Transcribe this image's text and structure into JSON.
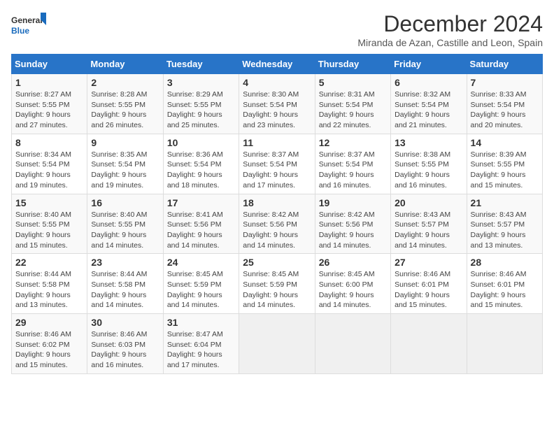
{
  "logo": {
    "line1": "General",
    "line2": "Blue"
  },
  "title": "December 2024",
  "subtitle": "Miranda de Azan, Castille and Leon, Spain",
  "weekdays": [
    "Sunday",
    "Monday",
    "Tuesday",
    "Wednesday",
    "Thursday",
    "Friday",
    "Saturday"
  ],
  "weeks": [
    [
      {
        "day": "1",
        "info": "Sunrise: 8:27 AM\nSunset: 5:55 PM\nDaylight: 9 hours\nand 27 minutes."
      },
      {
        "day": "2",
        "info": "Sunrise: 8:28 AM\nSunset: 5:55 PM\nDaylight: 9 hours\nand 26 minutes."
      },
      {
        "day": "3",
        "info": "Sunrise: 8:29 AM\nSunset: 5:55 PM\nDaylight: 9 hours\nand 25 minutes."
      },
      {
        "day": "4",
        "info": "Sunrise: 8:30 AM\nSunset: 5:54 PM\nDaylight: 9 hours\nand 23 minutes."
      },
      {
        "day": "5",
        "info": "Sunrise: 8:31 AM\nSunset: 5:54 PM\nDaylight: 9 hours\nand 22 minutes."
      },
      {
        "day": "6",
        "info": "Sunrise: 8:32 AM\nSunset: 5:54 PM\nDaylight: 9 hours\nand 21 minutes."
      },
      {
        "day": "7",
        "info": "Sunrise: 8:33 AM\nSunset: 5:54 PM\nDaylight: 9 hours\nand 20 minutes."
      }
    ],
    [
      {
        "day": "8",
        "info": "Sunrise: 8:34 AM\nSunset: 5:54 PM\nDaylight: 9 hours\nand 19 minutes."
      },
      {
        "day": "9",
        "info": "Sunrise: 8:35 AM\nSunset: 5:54 PM\nDaylight: 9 hours\nand 19 minutes."
      },
      {
        "day": "10",
        "info": "Sunrise: 8:36 AM\nSunset: 5:54 PM\nDaylight: 9 hours\nand 18 minutes."
      },
      {
        "day": "11",
        "info": "Sunrise: 8:37 AM\nSunset: 5:54 PM\nDaylight: 9 hours\nand 17 minutes."
      },
      {
        "day": "12",
        "info": "Sunrise: 8:37 AM\nSunset: 5:54 PM\nDaylight: 9 hours\nand 16 minutes."
      },
      {
        "day": "13",
        "info": "Sunrise: 8:38 AM\nSunset: 5:55 PM\nDaylight: 9 hours\nand 16 minutes."
      },
      {
        "day": "14",
        "info": "Sunrise: 8:39 AM\nSunset: 5:55 PM\nDaylight: 9 hours\nand 15 minutes."
      }
    ],
    [
      {
        "day": "15",
        "info": "Sunrise: 8:40 AM\nSunset: 5:55 PM\nDaylight: 9 hours\nand 15 minutes."
      },
      {
        "day": "16",
        "info": "Sunrise: 8:40 AM\nSunset: 5:55 PM\nDaylight: 9 hours\nand 14 minutes."
      },
      {
        "day": "17",
        "info": "Sunrise: 8:41 AM\nSunset: 5:56 PM\nDaylight: 9 hours\nand 14 minutes."
      },
      {
        "day": "18",
        "info": "Sunrise: 8:42 AM\nSunset: 5:56 PM\nDaylight: 9 hours\nand 14 minutes."
      },
      {
        "day": "19",
        "info": "Sunrise: 8:42 AM\nSunset: 5:56 PM\nDaylight: 9 hours\nand 14 minutes."
      },
      {
        "day": "20",
        "info": "Sunrise: 8:43 AM\nSunset: 5:57 PM\nDaylight: 9 hours\nand 14 minutes."
      },
      {
        "day": "21",
        "info": "Sunrise: 8:43 AM\nSunset: 5:57 PM\nDaylight: 9 hours\nand 13 minutes."
      }
    ],
    [
      {
        "day": "22",
        "info": "Sunrise: 8:44 AM\nSunset: 5:58 PM\nDaylight: 9 hours\nand 13 minutes."
      },
      {
        "day": "23",
        "info": "Sunrise: 8:44 AM\nSunset: 5:58 PM\nDaylight: 9 hours\nand 14 minutes."
      },
      {
        "day": "24",
        "info": "Sunrise: 8:45 AM\nSunset: 5:59 PM\nDaylight: 9 hours\nand 14 minutes."
      },
      {
        "day": "25",
        "info": "Sunrise: 8:45 AM\nSunset: 5:59 PM\nDaylight: 9 hours\nand 14 minutes."
      },
      {
        "day": "26",
        "info": "Sunrise: 8:45 AM\nSunset: 6:00 PM\nDaylight: 9 hours\nand 14 minutes."
      },
      {
        "day": "27",
        "info": "Sunrise: 8:46 AM\nSunset: 6:01 PM\nDaylight: 9 hours\nand 15 minutes."
      },
      {
        "day": "28",
        "info": "Sunrise: 8:46 AM\nSunset: 6:01 PM\nDaylight: 9 hours\nand 15 minutes."
      }
    ],
    [
      {
        "day": "29",
        "info": "Sunrise: 8:46 AM\nSunset: 6:02 PM\nDaylight: 9 hours\nand 15 minutes."
      },
      {
        "day": "30",
        "info": "Sunrise: 8:46 AM\nSunset: 6:03 PM\nDaylight: 9 hours\nand 16 minutes."
      },
      {
        "day": "31",
        "info": "Sunrise: 8:47 AM\nSunset: 6:04 PM\nDaylight: 9 hours\nand 17 minutes."
      },
      null,
      null,
      null,
      null
    ]
  ]
}
